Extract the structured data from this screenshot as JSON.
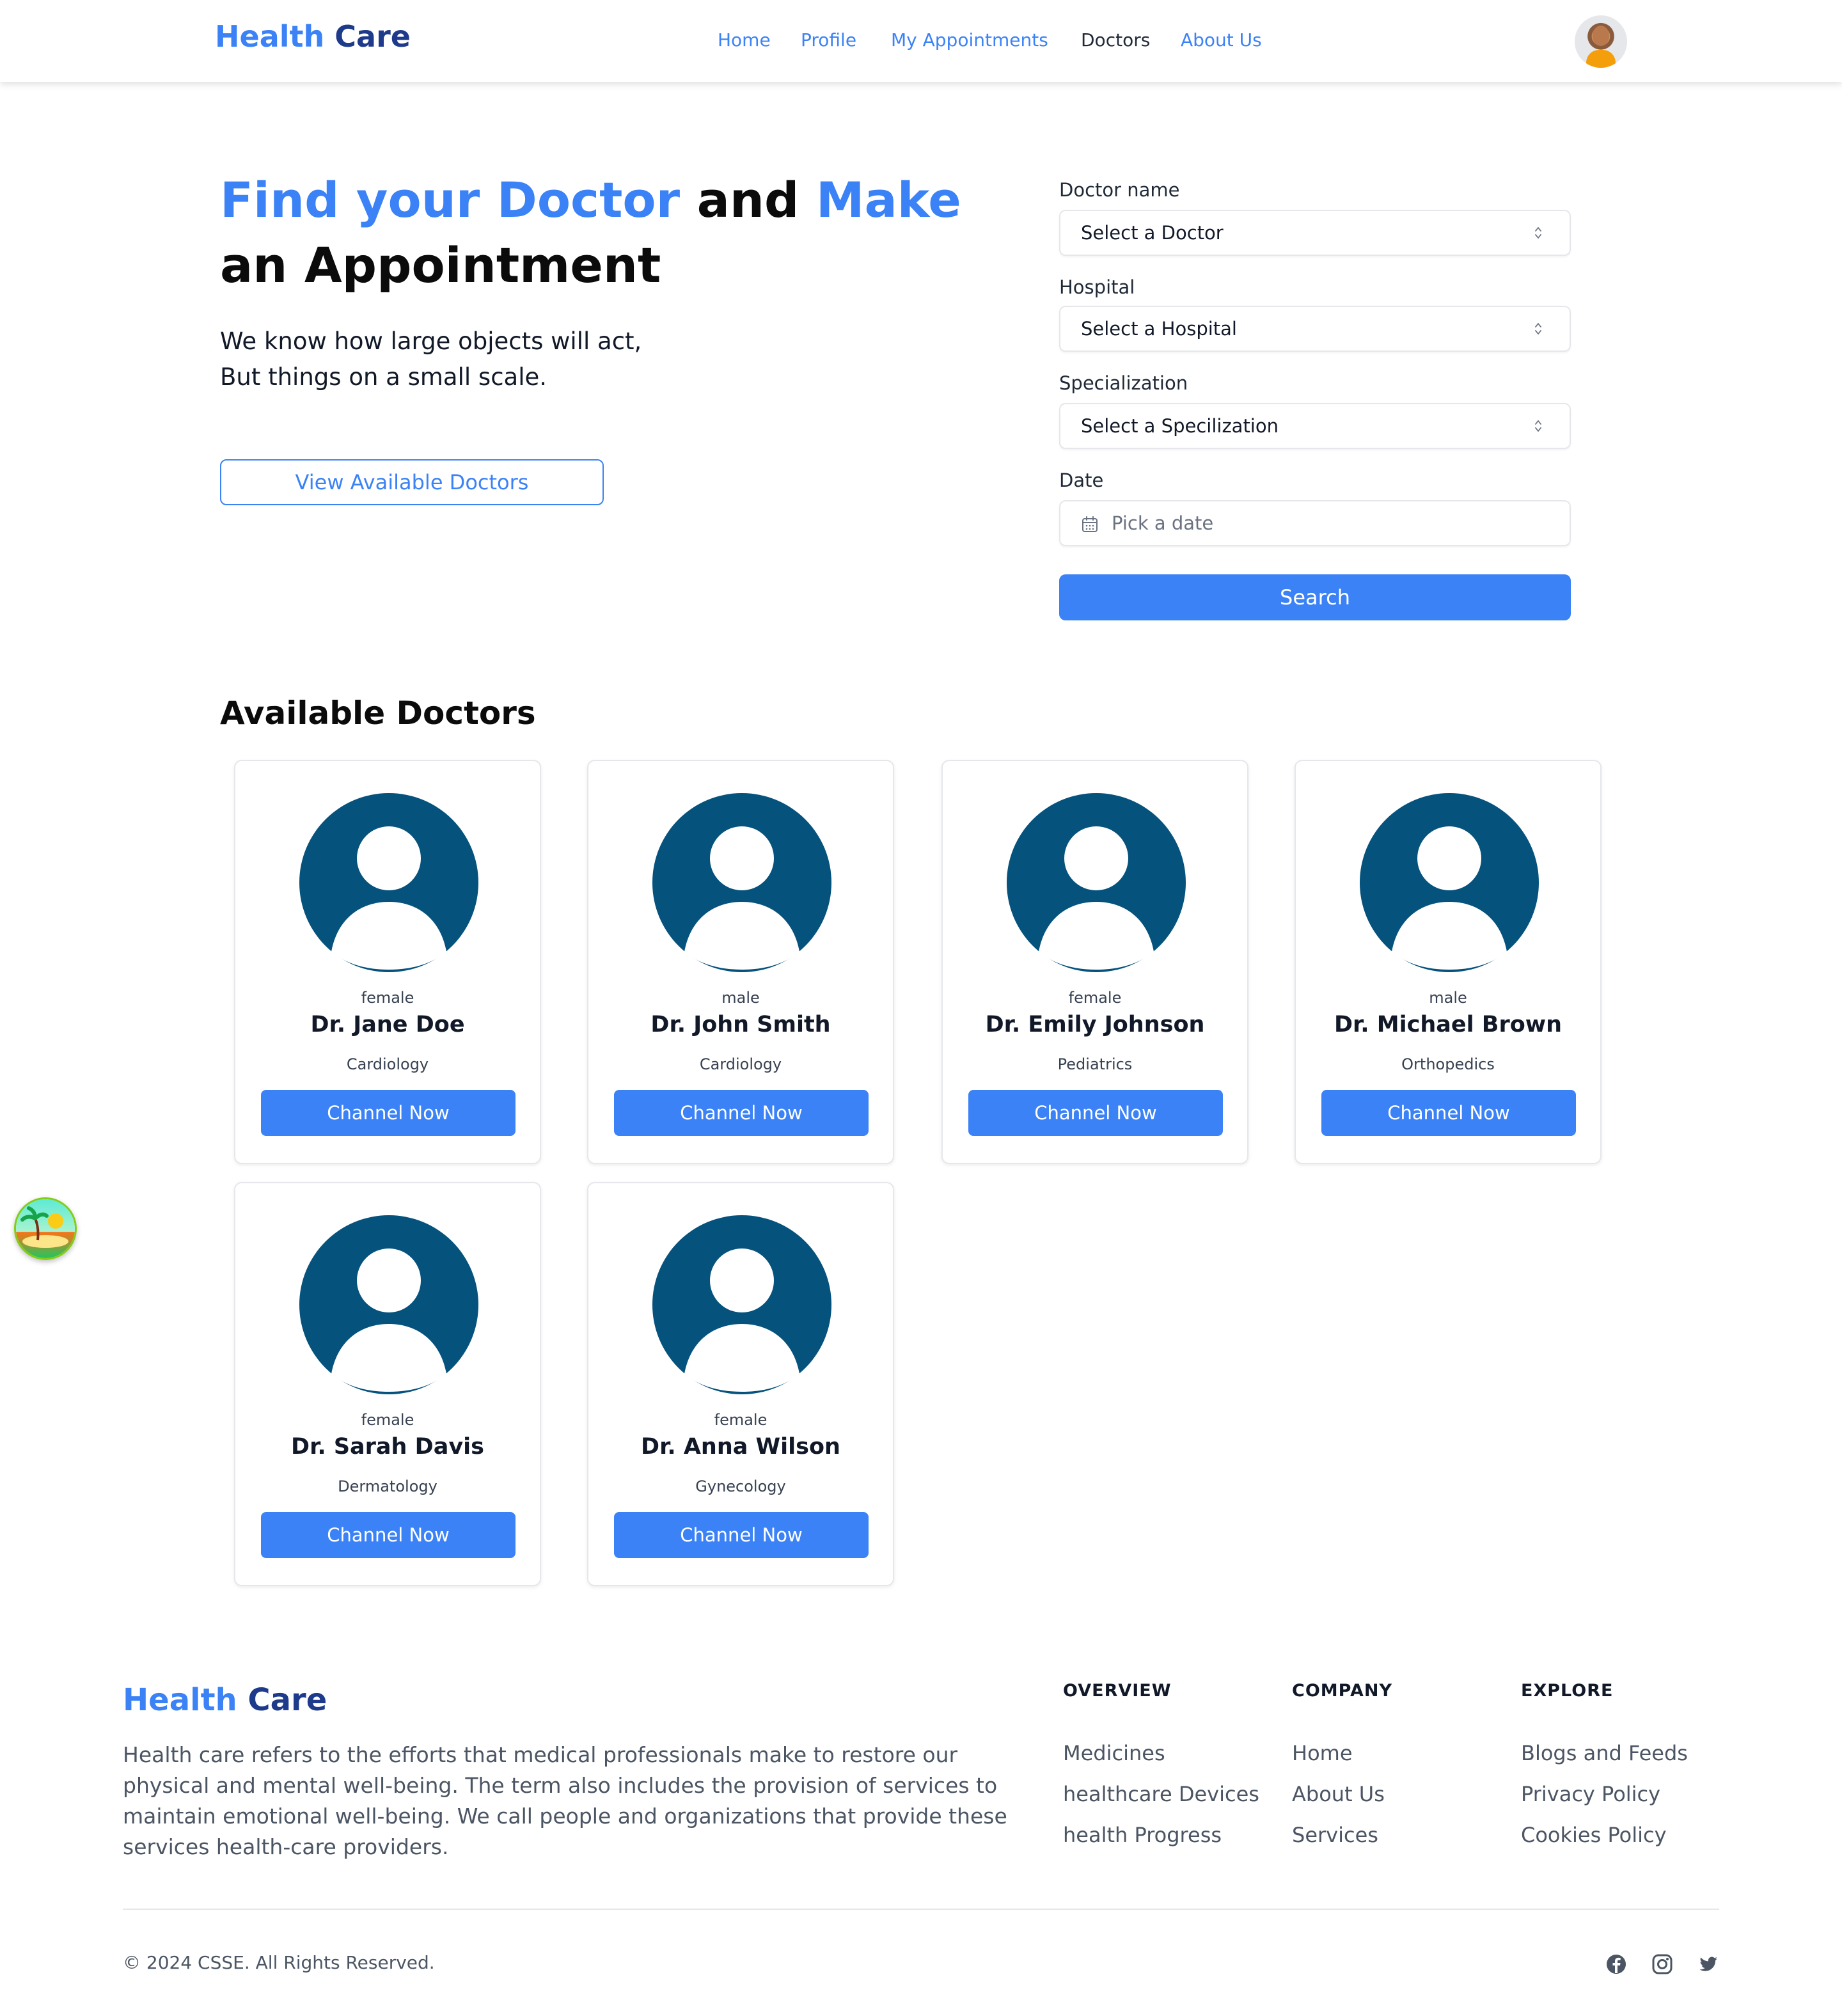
{
  "nav": {
    "brand_part1": "Health",
    "brand_part2": "Care",
    "links": [
      "Home",
      "Profile",
      "My Appointments",
      "Doctors",
      "About Us"
    ],
    "active": "Doctors"
  },
  "hero": {
    "title_part1": "Find your Doctor",
    "title_part2": "and",
    "title_part3": "Make",
    "title_part4": "an Appointment",
    "subtitle_line1": "We know how large objects will act,",
    "subtitle_line2": "But things on a small scale.",
    "cta_label": "View Available Doctors"
  },
  "form": {
    "doctor_label": "Doctor name",
    "doctor_value": "Select a Doctor",
    "hospital_label": "Hospital",
    "hospital_value": "Select a Hospital",
    "specialization_label": "Specialization",
    "specialization_value": "Select a Specilization",
    "date_label": "Date",
    "date_placeholder": "Pick a date",
    "search_label": "Search"
  },
  "doctors": {
    "section_title": "Available Doctors",
    "channel_label": "Channel Now",
    "list": [
      {
        "gender": "female",
        "name": "Dr. Jane Doe",
        "specialization": "Cardiology"
      },
      {
        "gender": "male",
        "name": "Dr. John Smith",
        "specialization": "Cardiology"
      },
      {
        "gender": "female",
        "name": "Dr. Emily Johnson",
        "specialization": "Pediatrics"
      },
      {
        "gender": "male",
        "name": "Dr. Michael Brown",
        "specialization": "Orthopedics"
      },
      {
        "gender": "female",
        "name": "Dr. Sarah Davis",
        "specialization": "Dermatology"
      },
      {
        "gender": "female",
        "name": "Dr. Anna Wilson",
        "specialization": "Gynecology"
      }
    ]
  },
  "footer": {
    "brand_part1": "Health",
    "brand_part2": "Care",
    "description": "Health care refers to the efforts that medical professionals make to restore our physical and mental well-being. The term also includes the provision of services to maintain emotional well-being. We call people and organizations that provide these services health-care providers.",
    "columns": [
      {
        "heading": "OVERVIEW",
        "items": [
          "Medicines",
          "healthcare Devices",
          "health Progress"
        ]
      },
      {
        "heading": "COMPANY",
        "items": [
          "Home",
          "About Us",
          "Services"
        ]
      },
      {
        "heading": "EXPLORE",
        "items": [
          "Blogs and Feeds",
          "Privacy Policy",
          "Cookies Policy"
        ]
      }
    ],
    "copyright": "© 2024 CSSE. All Rights Reserved.",
    "social_icons": [
      "facebook-icon",
      "instagram-icon",
      "twitter-icon"
    ]
  },
  "colors": {
    "primary": "#3b82f6",
    "brand_dark": "#1e3a8a",
    "avatar": "#05527d"
  }
}
